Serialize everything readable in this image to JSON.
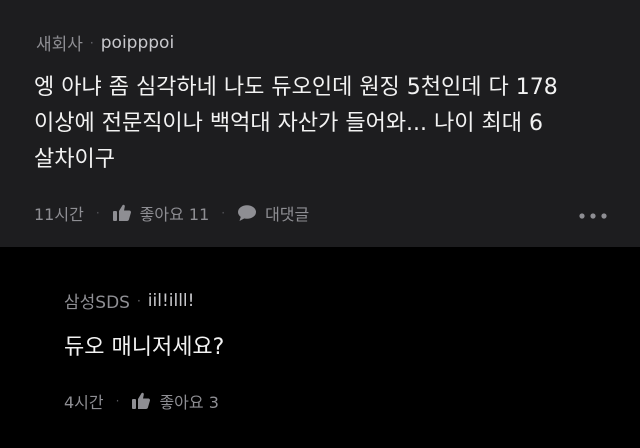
{
  "colors": {
    "main_comment_bg": "#1d1d1f",
    "reply_bg": "#000000",
    "meta_text": "#8e8e93",
    "body_text": "#f2f2f2"
  },
  "comment": {
    "company": "새회사",
    "separator": "·",
    "nickname": "poipppoi",
    "lines": [
      "엥 아냐 좀 심각하네 나도 듀오인데 원징 5천인데 다 178",
      "이상에 전문직이나 백억대 자산가 들어와... 나이 최대 6",
      "살차이구"
    ],
    "time": "11시간",
    "like_icon": "thumbs-up-icon",
    "like_label": "좋아요 11",
    "reply_icon": "speech-bubble-icon",
    "reply_label": "대댓글",
    "more_icon": "more-dots-icon"
  },
  "reply": {
    "company": "삼성SDS",
    "separator": "·",
    "nickname": "iil!illl!",
    "text": "듀오 매니저세요?",
    "time": "4시간",
    "like_icon": "thumbs-up-icon",
    "like_label": "좋아요 3"
  }
}
